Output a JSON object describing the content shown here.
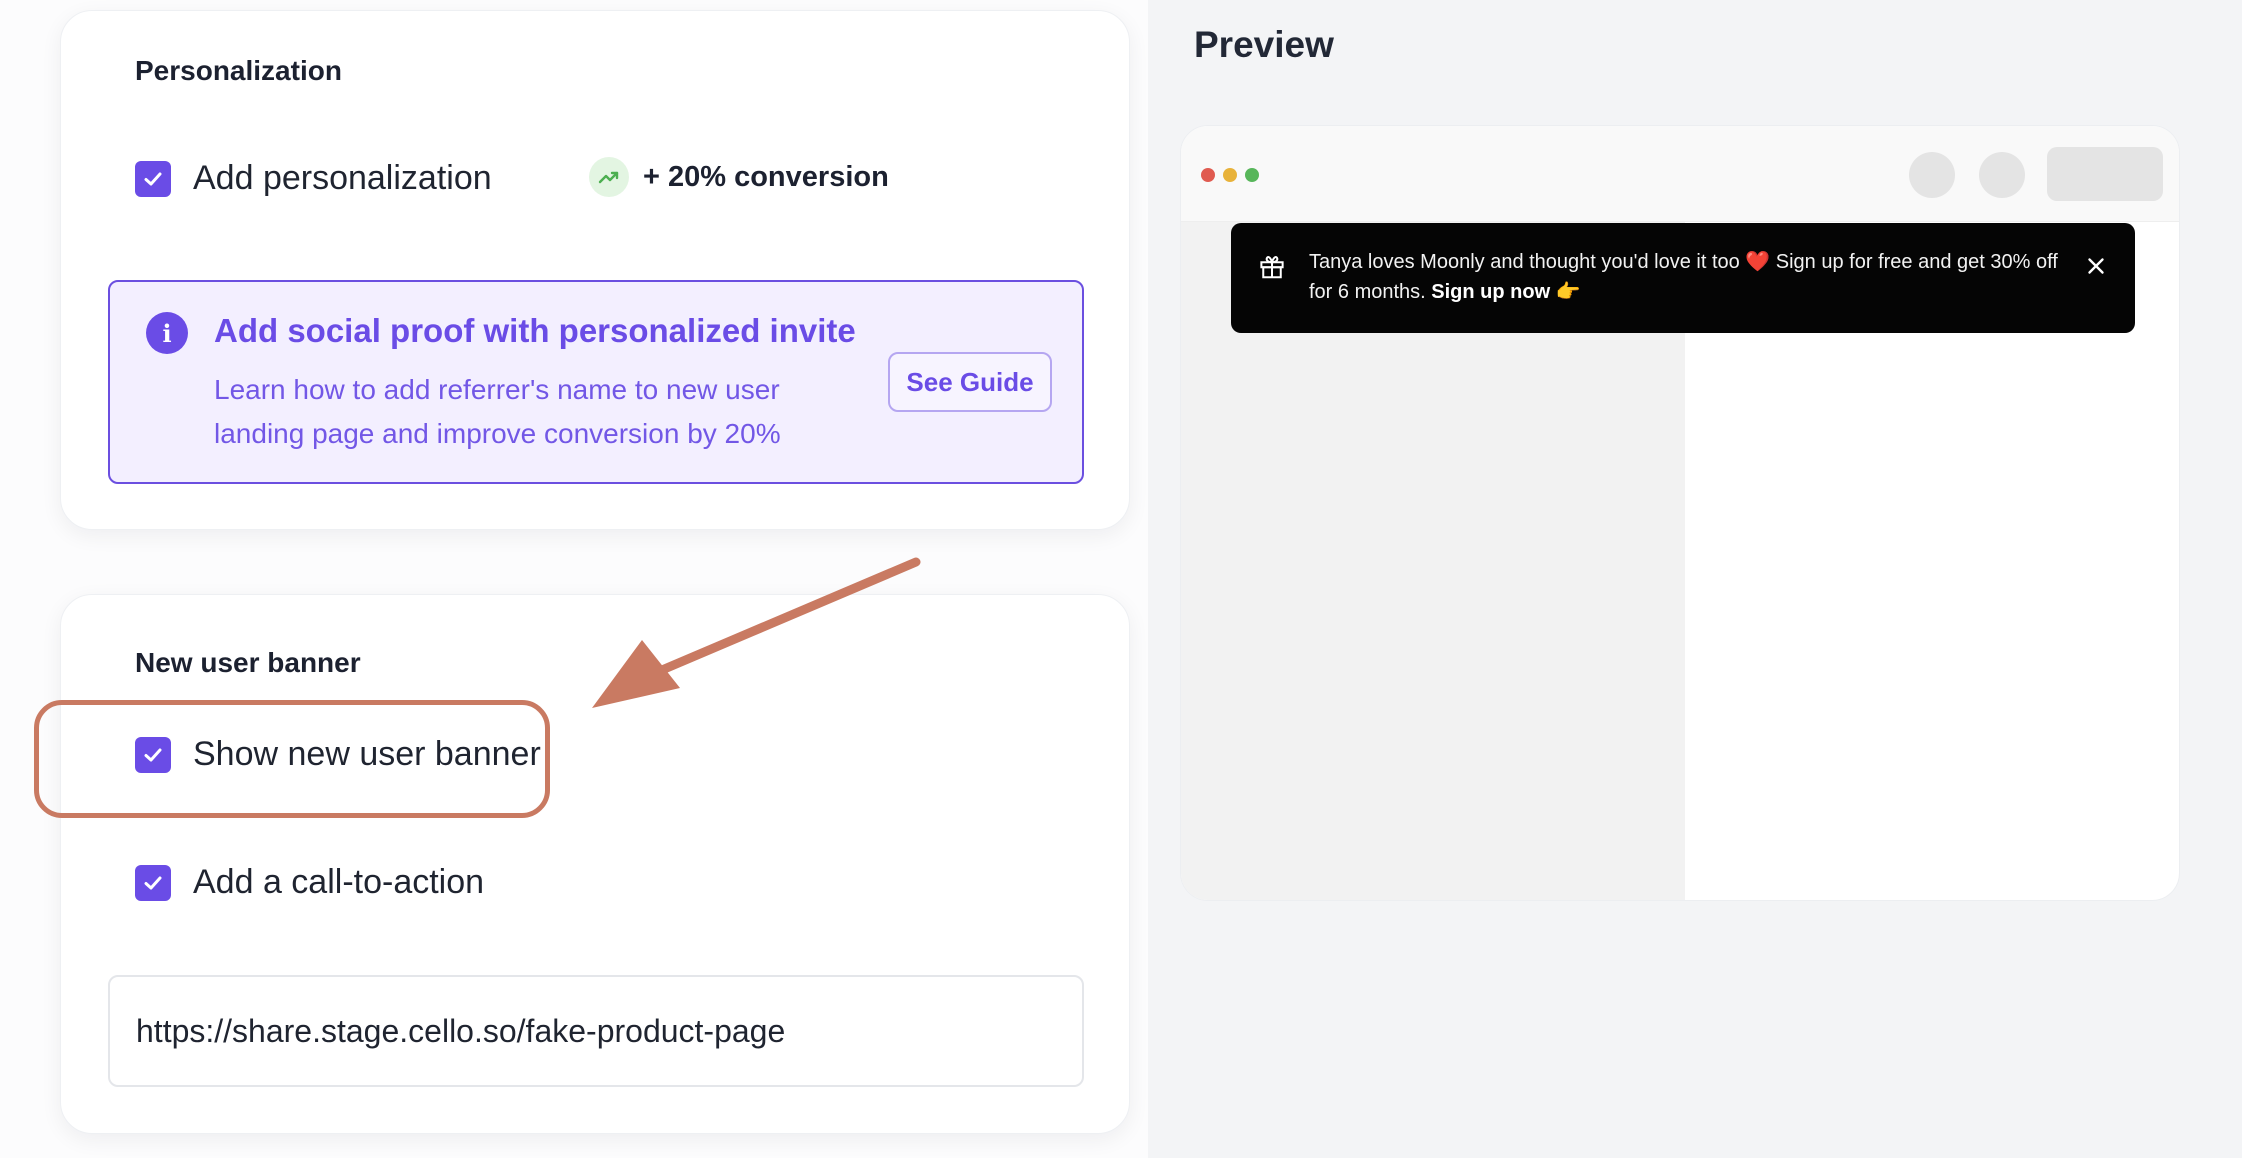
{
  "personalization": {
    "title": "Personalization",
    "checkbox_label": "Add personalization",
    "checked": true,
    "boost_text": "+ 20% conversion",
    "info": {
      "title": "Add social proof with personalized invite",
      "body": "Learn how to add referrer's name to new user landing page and improve conversion by 20%",
      "button_label": "See Guide"
    }
  },
  "new_user_banner": {
    "title": "New user banner",
    "show_banner_label": "Show new user banner",
    "show_banner_checked": true,
    "cta_label": "Add a call-to-action",
    "cta_checked": true,
    "cta_url": "https://share.stage.cello.so/fake-product-page"
  },
  "preview": {
    "title": "Preview",
    "banner": {
      "message": "Tanya loves Moonly and thought you'd love it too ❤️ Sign up for free and get 30% off for 6 months.",
      "cta": "Sign up now 👉"
    }
  },
  "colors": {
    "accent": "#6a4ce6",
    "annotation": "#c97a62",
    "boost_green": "#4caf50",
    "window_dots": [
      "#e05b50",
      "#e8b23a",
      "#57b65a"
    ]
  },
  "icons": {
    "checkbox": "check-icon",
    "boost": "trend-up-icon",
    "info": "info-icon",
    "banner_gift": "gift-icon",
    "banner_close": "close-icon"
  }
}
